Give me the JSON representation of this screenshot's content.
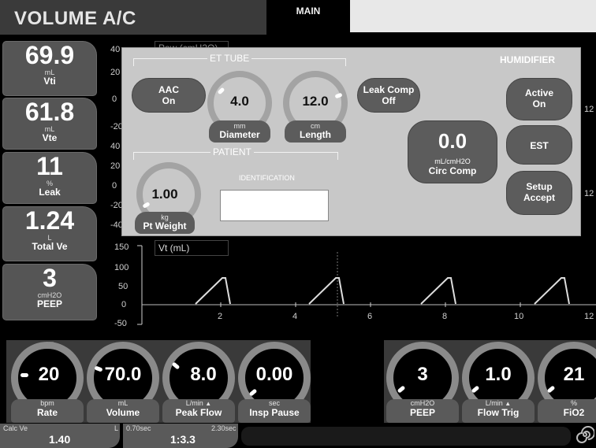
{
  "header": {
    "mode_title": "VOLUME A/C",
    "main_tab": "MAIN"
  },
  "monitored": [
    {
      "value": "69.9",
      "unit": "mL",
      "label": "Vti"
    },
    {
      "value": "61.8",
      "unit": "mL",
      "label": "Vte"
    },
    {
      "value": "11",
      "unit": "%",
      "label": "Leak"
    },
    {
      "value": "1.24",
      "unit": "L",
      "label": "Total Ve"
    },
    {
      "value": "3",
      "unit": "cmH2O",
      "label": "PEEP"
    }
  ],
  "paw_wave": {
    "title": "Paw (cmH2O)",
    "y_ticks": [
      "40",
      "20",
      "0",
      "-20",
      "40",
      "20",
      "0",
      "-20",
      "-40"
    ]
  },
  "vt_wave": {
    "title": "Vt (mL)",
    "y_ticks": [
      "150",
      "100",
      "50",
      "0",
      "-50"
    ],
    "x_ticks": [
      "2",
      "4",
      "6",
      "8",
      "10",
      "12"
    ],
    "right_ticks": [
      "12",
      "12"
    ]
  },
  "dialog": {
    "et_tube_title": "ET TUBE",
    "humidifier_title": "HUMIDIFIER",
    "patient_title": "PATIENT",
    "aac": {
      "line1": "AAC",
      "line2": "On"
    },
    "diameter": {
      "value": "4.0",
      "unit": "mm",
      "label": "Diameter"
    },
    "length": {
      "value": "12.0",
      "unit": "cm",
      "label": "Length"
    },
    "leak_comp": {
      "line1": "Leak Comp",
      "line2": "Off"
    },
    "circ_comp": {
      "value": "0.0",
      "unit": "mL/cmH2O",
      "label": "Circ Comp"
    },
    "humidifier_active": {
      "line1": "Active",
      "line2": "On"
    },
    "est": "EST",
    "setup_accept": {
      "line1": "Setup",
      "line2": "Accept"
    },
    "pt_weight": {
      "value": "1.00",
      "unit": "kg",
      "label": "Pt Weight"
    },
    "identification_label": "IDENTIFICATION",
    "identification_value": ""
  },
  "settings_left": [
    {
      "value": "20",
      "unit": "bpm",
      "label": "Rate"
    },
    {
      "value": "70.0",
      "unit": "mL",
      "label": "Volume"
    },
    {
      "value": "8.0",
      "unit": "L/min",
      "label": "Peak Flow",
      "marker": "▲"
    },
    {
      "value": "0.00",
      "unit": "sec",
      "label": "Insp Pause"
    }
  ],
  "settings_right": [
    {
      "value": "3",
      "unit": "cmH2O",
      "label": "PEEP"
    },
    {
      "value": "1.0",
      "unit": "L/min",
      "label": "Flow Trig",
      "marker": "▲"
    },
    {
      "value": "21",
      "unit": "%",
      "label": "FiO2"
    }
  ],
  "status": {
    "calc_ve_label": "Calc Ve",
    "calc_ve_unit": "L",
    "calc_ve_value": "1.40",
    "ti_label": "0.70sec",
    "te_label": "2.30sec",
    "ie_ratio": "1:3.3"
  },
  "colors": {
    "dialog_bg": "#c8c8c8",
    "button": "#5c5c5c",
    "waveform": "#dddddd"
  }
}
